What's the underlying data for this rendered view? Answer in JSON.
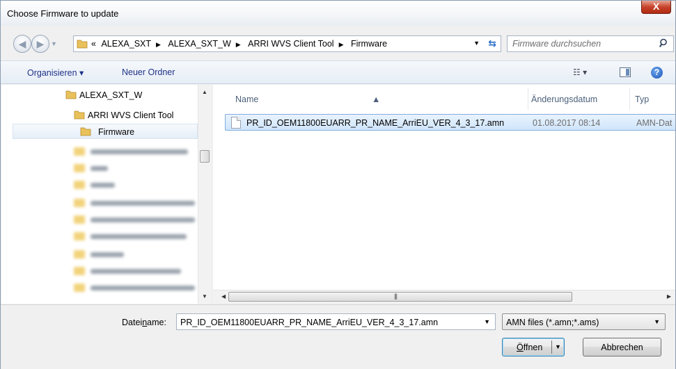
{
  "window": {
    "title": "Choose Firmware to update",
    "close_label": "X"
  },
  "address": {
    "prefix": "«",
    "crumbs": [
      "ALEXA_SXT",
      "ALEXA_SXT_W",
      "ARRI WVS Client Tool",
      "Firmware"
    ]
  },
  "search": {
    "placeholder": "Firmware durchsuchen"
  },
  "toolbar": {
    "organize_label": "Organisieren ▾",
    "new_folder_label": "Neuer Ordner",
    "help_label": "?"
  },
  "tree": {
    "items": [
      {
        "label": "ALEXA_SXT_W",
        "level": 1
      },
      {
        "label": "ARRI WVS Client Tool",
        "level": 2
      },
      {
        "label": "Firmware",
        "level": 3,
        "selected": true
      }
    ]
  },
  "files": {
    "columns": {
      "name": "Name",
      "date": "Änderungsdatum",
      "type": "Typ"
    },
    "rows": [
      {
        "name": "PR_ID_OEM11800EUARR_PR_NAME_ArriEU_VER_4_3_17.amn",
        "date": "01.08.2017 08:14",
        "type": "AMN-Dat"
      }
    ]
  },
  "bottom": {
    "filename_label_pre": "Datei",
    "filename_label_u": "n",
    "filename_label_post": "ame:",
    "filename_value": "PR_ID_OEM11800EUARR_PR_NAME_ArriEU_VER_4_3_17.amn",
    "filter_value": "AMN files (*.amn;*.ams)",
    "open_u": "Ö",
    "open_rest": "ffnen",
    "cancel_label": "Abbrechen"
  },
  "colors": {
    "accent": "#1e3287",
    "selection": "#cfe5fc",
    "title_close": "#c7432b"
  }
}
